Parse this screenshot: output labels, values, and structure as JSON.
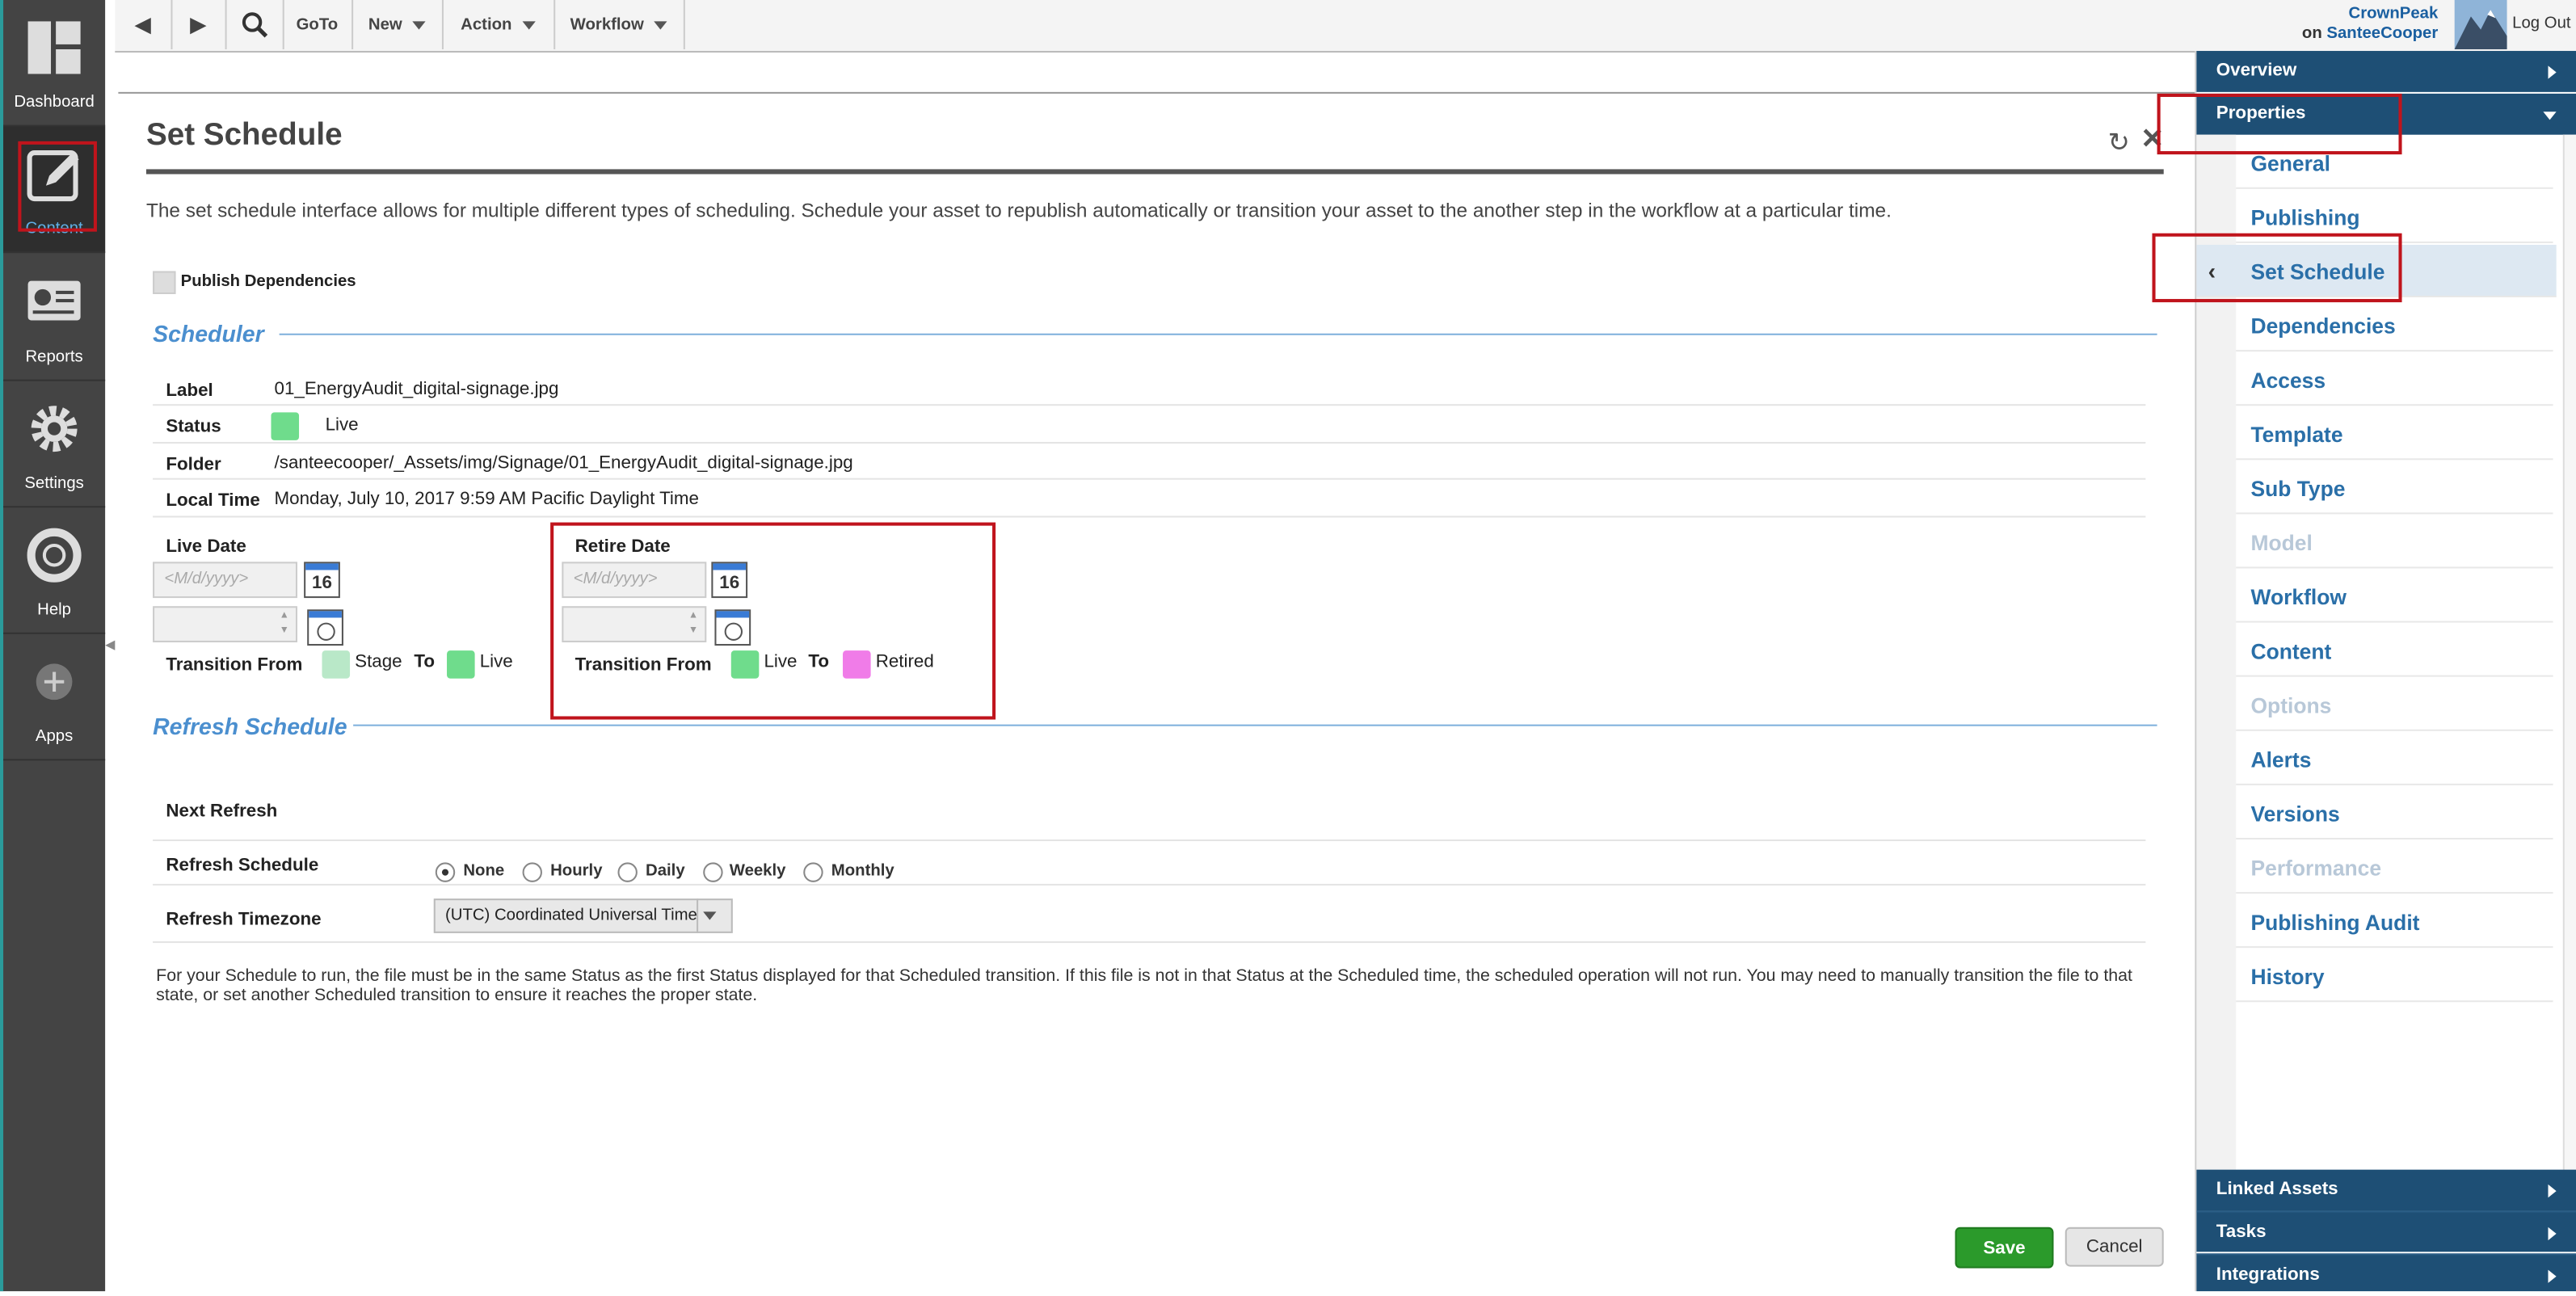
{
  "rail": {
    "items": [
      {
        "label": "Dashboard",
        "icon": "dashboard-icon"
      },
      {
        "label": "Content",
        "icon": "edit-icon"
      },
      {
        "label": "Reports",
        "icon": "reports-icon"
      },
      {
        "label": "Settings",
        "icon": "gear-icon"
      },
      {
        "label": "Help",
        "icon": "lifebuoy-icon"
      },
      {
        "label": "Apps",
        "icon": "plus-icon"
      }
    ]
  },
  "toolbar": {
    "goto": "GoTo",
    "new": "New",
    "action": "Action",
    "workflow": "Workflow",
    "user_line1": "CrownPeak",
    "user_on": "on",
    "user_site": "SanteeCooper",
    "logout": "Log Out"
  },
  "dialog": {
    "title": "Set Schedule",
    "intro": "The set schedule interface allows for multiple different types of scheduling. Schedule your asset to republish automatically or transition your asset to the another step in the workflow at a particular time.",
    "publish_dependencies": "Publish Dependencies",
    "scheduler_title": "Scheduler",
    "label_label": "Label",
    "label_value": "01_EnergyAudit_digital-signage.jpg",
    "status_label": "Status",
    "status_value": "Live",
    "folder_label": "Folder",
    "folder_value": "/santeecooper/_Assets/img/Signage/01_EnergyAudit_digital-signage.jpg",
    "localtime_label": "Local Time",
    "localtime_value": "Monday, July 10, 2017 9:59 AM  Pacific Daylight Time",
    "live_date": {
      "title": "Live Date",
      "placeholder": "<M/d/yyyy>",
      "cal_day": "16",
      "transition_from": "Transition From",
      "from": "Stage",
      "to_word": "To",
      "to": "Live"
    },
    "retire_date": {
      "title": "Retire Date",
      "placeholder": "<M/d/yyyy>",
      "cal_day": "16",
      "transition_from": "Transition From",
      "from": "Live",
      "to_word": "To",
      "to": "Retired"
    },
    "refresh_title": "Refresh Schedule",
    "next_refresh_label": "Next Refresh",
    "refresh_schedule_label": "Refresh Schedule",
    "refresh_options": [
      "None",
      "Hourly",
      "Daily",
      "Weekly",
      "Monthly"
    ],
    "refresh_selected": "None",
    "timezone_label": "Refresh Timezone",
    "timezone_value": "(UTC) Coordinated Universal Time",
    "note": "For your Schedule to run, the file must be in the same Status as the first Status displayed for that Scheduled transition. If this file is not in that Status at the Scheduled time, the scheduled operation will not run. You may need to manually transition the file to that state, or set another Scheduled transition to ensure it reaches the proper state.",
    "save": "Save",
    "cancel": "Cancel"
  },
  "right_panel": {
    "overview": "Overview",
    "properties": "Properties",
    "items": [
      "General",
      "Publishing",
      "Set Schedule",
      "Dependencies",
      "Access",
      "Template",
      "Sub Type",
      "Model",
      "Workflow",
      "Content",
      "Options",
      "Alerts",
      "Versions",
      "Performance",
      "Publishing Audit",
      "History"
    ],
    "selected": "Set Schedule",
    "disabled": [
      "Model",
      "Options",
      "Performance"
    ],
    "linked_assets": "Linked Assets",
    "tasks": "Tasks",
    "integrations": "Integrations"
  },
  "colors": {
    "stage": "#b9e8c8",
    "live": "#6fdc8c",
    "retired": "#f07ce8",
    "accent": "#4b8fcf",
    "highlight_box": "#c0141c"
  }
}
